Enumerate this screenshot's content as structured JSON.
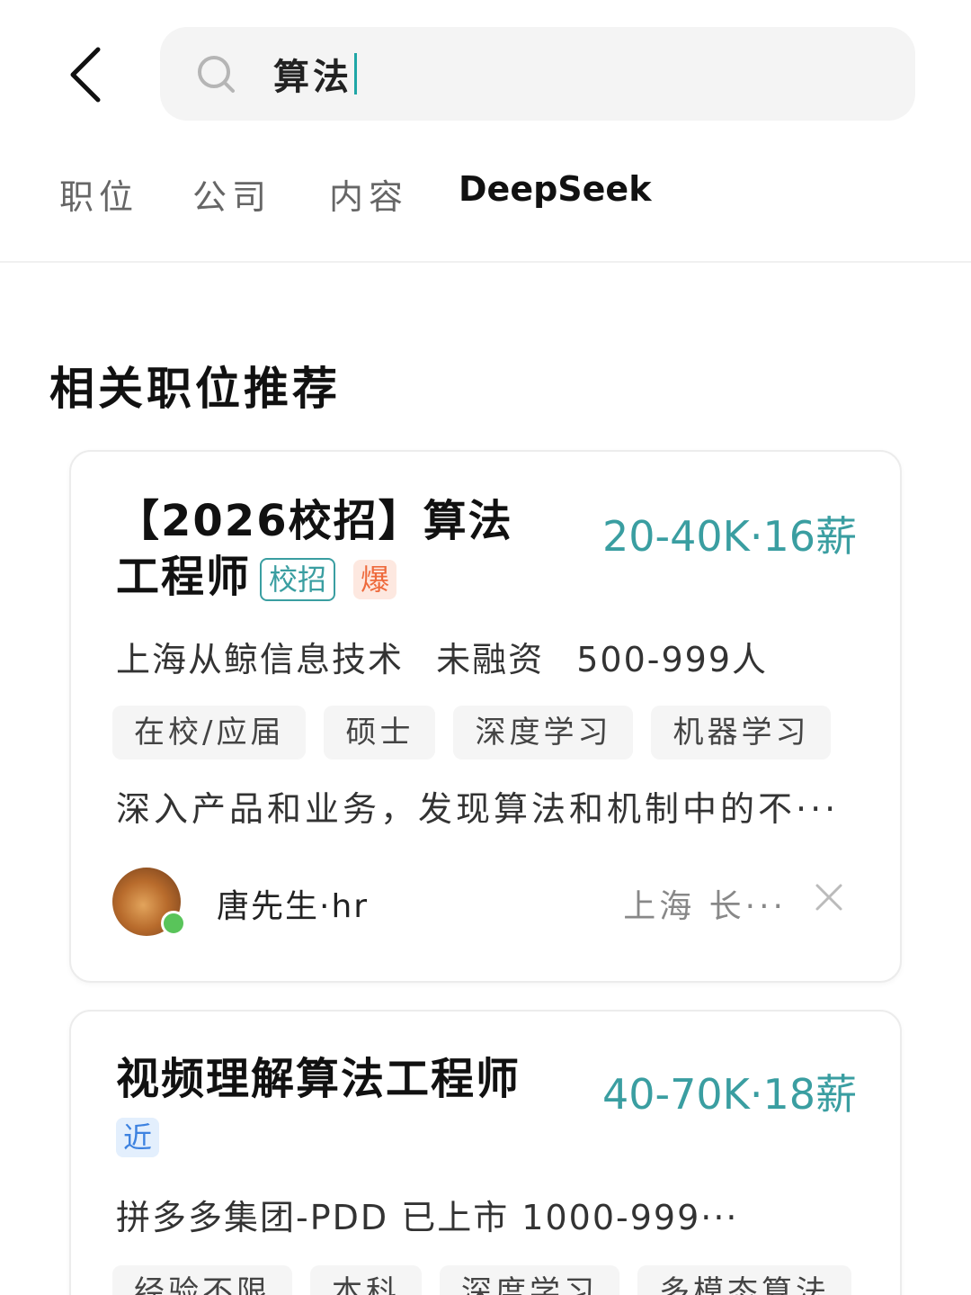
{
  "search": {
    "query": "算法"
  },
  "tabs": [
    {
      "label": "职位"
    },
    {
      "label": "公司"
    },
    {
      "label": "内容"
    },
    {
      "label": "DeepSeek"
    }
  ],
  "section": {
    "title": "相关职位推荐"
  },
  "jobs": [
    {
      "title_line1": "【2026校招】算法",
      "title_line2": "工程师",
      "badges": [
        "校招",
        "爆"
      ],
      "salary": "20-40K·16薪",
      "company": "上海从鲸信息技术",
      "funding": "未融资",
      "size": "500-999人",
      "tags": [
        "在校/应届",
        "硕士",
        "深度学习",
        "机器学习"
      ],
      "description": "深入产品和业务，发现算法和机制中的不···",
      "recruiter": {
        "name": "唐先生·hr",
        "location": "上海 长···"
      }
    },
    {
      "title_line1": "视频理解算法工程师",
      "badges": [
        "近"
      ],
      "salary": "40-70K·18薪",
      "company_line": "拼多多集团-PDD 已上市 1000-999···",
      "tags": [
        "经验不限",
        "本科",
        "深度学习",
        "多模态算法"
      ]
    }
  ],
  "colors": {
    "accent": "#3a9ea1",
    "hot": "#ee6a3c",
    "recent": "#3d82e0",
    "online": "#59c45a"
  }
}
